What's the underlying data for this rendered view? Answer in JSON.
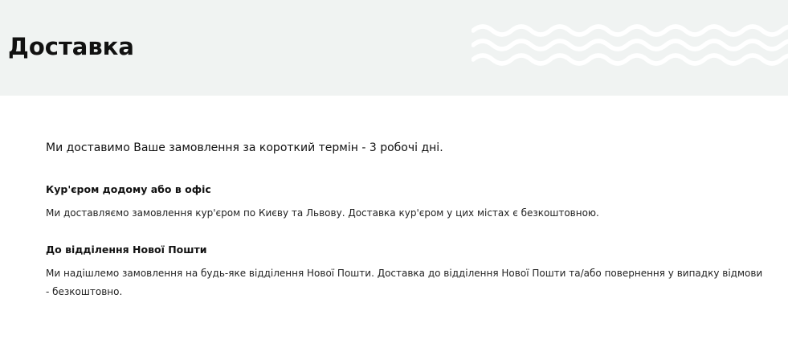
{
  "header": {
    "title": "Доставка"
  },
  "intro": "Ми доставимо Ваше замовлення за короткий термін - 3 робочі дні.",
  "sections": [
    {
      "heading": "Кур'єром додому або в офіс",
      "text": "Ми доставляємо замовлення кур'єром по Києву та Львову. Доставка кур'єром у цих містах є безкоштовною."
    },
    {
      "heading": "До відділення Нової Пошти",
      "text": "Ми надішлемо замовлення на будь-яке відділення Нової Пошти. Доставка до відділення Нової Пошти та/або повернення у випадку відмови - безкоштовно."
    }
  ],
  "colors": {
    "header_background": "#f0f3f2",
    "wave_decoration": "#ffffff",
    "text": "#111111"
  }
}
